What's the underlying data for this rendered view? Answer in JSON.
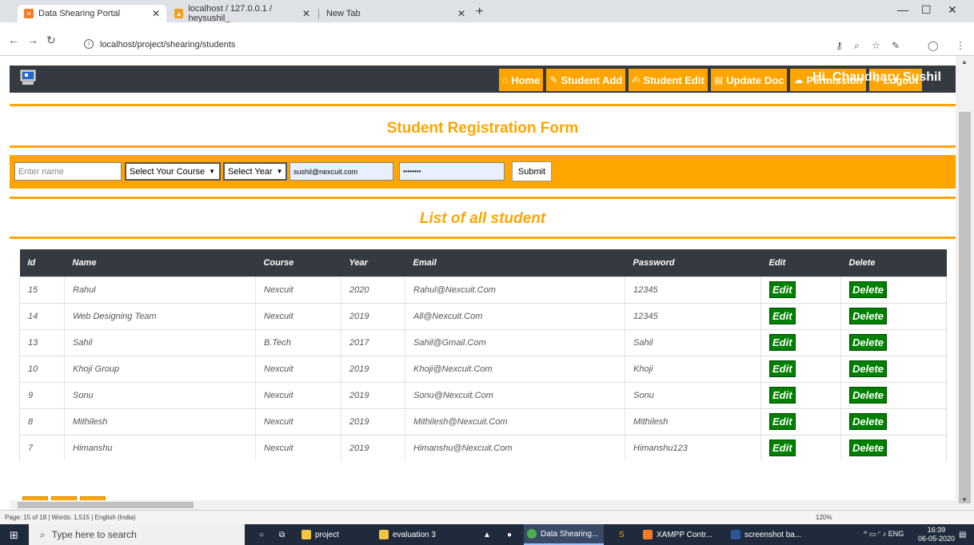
{
  "browser": {
    "tabs": [
      {
        "title": "Data Shearing Portal",
        "active": true
      },
      {
        "title": "localhost / 127.0.0.1 / heysushil_",
        "active": false
      },
      {
        "title": "New Tab",
        "active": false
      }
    ],
    "url": "localhost/project/shearing/students",
    "colors": {
      "tab_bar": "#dee1e6",
      "favicon_xampp": "#fb7a24"
    }
  },
  "site": {
    "nav": [
      {
        "icon": "home-icon",
        "label": "Home"
      },
      {
        "icon": "pencil-icon",
        "label": "Student Add"
      },
      {
        "icon": "edit-icon",
        "label": "Student Edit"
      },
      {
        "icon": "document-icon",
        "label": "Update Doc"
      },
      {
        "icon": "cloud-icon",
        "label": "Permission"
      },
      {
        "icon": "pencil-icon",
        "label": "Logout"
      }
    ],
    "greeting": "Hi, Chaudhary Sushil",
    "colors": {
      "header": "#343a40",
      "accent": "#ffa500",
      "action_green": "#008000"
    }
  },
  "form": {
    "title": "Student Registration Form",
    "name_placeholder": "Enter name",
    "course_select": "Select Your Course",
    "year_select": "Select Year",
    "email_value": "sushil@nexcuit.com",
    "password_value": "••••••••",
    "submit_label": "Submit"
  },
  "list": {
    "title": "List of all student",
    "columns": [
      "Id",
      "Name",
      "Course",
      "Year",
      "Email",
      "Password",
      "Edit",
      "Delete"
    ],
    "edit_label": "Edit",
    "delete_label": "Delete",
    "rows": [
      {
        "id": "15",
        "name": "Rahul",
        "course": "Nexcuit",
        "year": "2020",
        "email": "Rahul@Nexcuit.Com",
        "password": "12345"
      },
      {
        "id": "14",
        "name": "Web Designing Team",
        "course": "Nexcuit",
        "year": "2019",
        "email": "All@Nexcuit.Com",
        "password": "12345"
      },
      {
        "id": "13",
        "name": "Sahil",
        "course": "B.Tech",
        "year": "2017",
        "email": "Sahil@Gmail.Com",
        "password": "Sahil"
      },
      {
        "id": "10",
        "name": "Khoji Group",
        "course": "Nexcuit",
        "year": "2019",
        "email": "Khoji@Nexcuit.Com",
        "password": "Khoji"
      },
      {
        "id": "9",
        "name": "Sonu",
        "course": "Nexcuit",
        "year": "2019",
        "email": "Sonu@Nexcuit.Com",
        "password": "Sonu"
      },
      {
        "id": "8",
        "name": "Mithilesh",
        "course": "Nexcuit",
        "year": "2019",
        "email": "Mithilesh@Nexcuit.Com",
        "password": "Mithilesh"
      },
      {
        "id": "7",
        "name": "Himanshu",
        "course": "Nexcuit",
        "year": "2019",
        "email": "Himanshu@Nexcuit.Com",
        "password": "Himanshu123"
      }
    ]
  },
  "word_status": {
    "left": "Page: 15 of 18  |  Words: 1,515  |  English (India)",
    "zoom": "120%"
  },
  "taskbar": {
    "search_placeholder": "Type here to search",
    "apps": [
      "project",
      "evaluation 3",
      "Data Shearing...",
      "XAMPP Contr...",
      "screenshot ba..."
    ],
    "tray_lang": "ENG",
    "time": "16:39",
    "date": "06-05-2020"
  }
}
